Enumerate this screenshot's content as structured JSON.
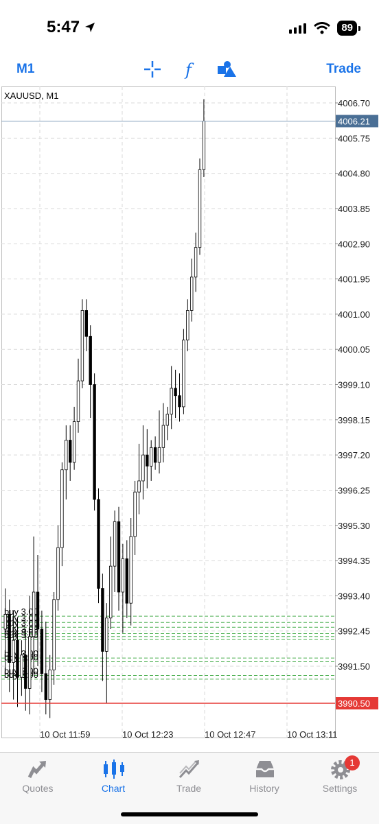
{
  "status": {
    "time": "5:47",
    "battery": "89"
  },
  "toolbar": {
    "timeframe": "M1",
    "trade_label": "Trade"
  },
  "chart": {
    "symbol_label": "XAUUSD, M1",
    "price_ticks": [
      "4006.70",
      "4005.75",
      "4004.80",
      "4003.85",
      "4002.90",
      "4001.95",
      "4001.00",
      "4000.05",
      "3999.10",
      "3998.15",
      "3997.20",
      "3996.25",
      "3995.30",
      "3994.35",
      "3993.40",
      "3992.45",
      "3991.50"
    ],
    "bid_price": "4006.21",
    "entry_price": "3990.50",
    "time_ticks": [
      "10 Oct 11:59",
      "10 Oct 12:23",
      "10 Oct 12:47",
      "10 Oct 13:11"
    ],
    "orders": [
      {
        "label": "buy 3.00",
        "price": 3992.85
      },
      {
        "label": "buy 3.00",
        "price": 3992.68
      },
      {
        "label": "buy 3.00",
        "price": 3992.55
      },
      {
        "label": "buy 3.00",
        "price": 3992.38
      },
      {
        "label": "buy 3.00",
        "price": 3992.3
      },
      {
        "label": "buy 3.00",
        "price": 3992.22
      },
      {
        "label": "buy 3.00",
        "price": 3991.72
      },
      {
        "label": "buy 3.00",
        "price": 3991.62
      },
      {
        "label": "buy 3.00",
        "price": 3991.25
      },
      {
        "label": "buy 3.00",
        "price": 3991.15
      }
    ],
    "colors": {
      "grid": "#d9d9d9",
      "bid_line": "#7f9bb8",
      "bid_label_bg": "#4a6f95",
      "entry_line": "#e53935",
      "entry_label_bg": "#e53935",
      "order_line": "#4caf50"
    }
  },
  "chart_data": {
    "type": "candlestick",
    "symbol": "XAUUSD",
    "timeframe": "M1",
    "ylim": [
      3990.0,
      4007.3
    ],
    "candles": [
      {
        "o": 3992.5,
        "h": 3993.6,
        "l": 3991.3,
        "c": 3992.9
      },
      {
        "o": 3992.9,
        "h": 3993.3,
        "l": 3990.8,
        "c": 3991.6
      },
      {
        "o": 3991.6,
        "h": 3993.0,
        "l": 3990.6,
        "c": 3992.2
      },
      {
        "o": 3992.2,
        "h": 3992.8,
        "l": 3990.4,
        "c": 3991.2
      },
      {
        "o": 3991.2,
        "h": 3992.2,
        "l": 3990.7,
        "c": 3991.8
      },
      {
        "o": 3991.8,
        "h": 3992.5,
        "l": 3990.3,
        "c": 3990.9
      },
      {
        "o": 3990.9,
        "h": 3993.4,
        "l": 3990.2,
        "c": 3992.3
      },
      {
        "o": 3992.3,
        "h": 3995.0,
        "l": 3991.3,
        "c": 3993.5
      },
      {
        "o": 3993.5,
        "h": 3994.5,
        "l": 3991.5,
        "c": 3992.5
      },
      {
        "o": 3992.5,
        "h": 3993.0,
        "l": 3990.8,
        "c": 3991.3
      },
      {
        "o": 3991.3,
        "h": 3992.7,
        "l": 3990.2,
        "c": 3990.6
      },
      {
        "o": 3990.6,
        "h": 3991.8,
        "l": 3990.1,
        "c": 3991.4
      },
      {
        "o": 3991.4,
        "h": 3993.5,
        "l": 3991.0,
        "c": 3993.3
      },
      {
        "o": 3993.3,
        "h": 3995.3,
        "l": 3993.0,
        "c": 3994.7
      },
      {
        "o": 3994.7,
        "h": 3997.0,
        "l": 3994.2,
        "c": 3996.8
      },
      {
        "o": 3996.8,
        "h": 3998.0,
        "l": 3996.0,
        "c": 3997.6
      },
      {
        "o": 3997.6,
        "h": 3998.0,
        "l": 3996.5,
        "c": 3997.0
      },
      {
        "o": 3997.0,
        "h": 3998.5,
        "l": 3996.8,
        "c": 3998.1
      },
      {
        "o": 3998.1,
        "h": 3999.8,
        "l": 3997.8,
        "c": 3999.2
      },
      {
        "o": 3999.2,
        "h": 4001.4,
        "l": 3999.0,
        "c": 4001.1
      },
      {
        "o": 4001.1,
        "h": 4001.4,
        "l": 4000.0,
        "c": 4000.4
      },
      {
        "o": 4000.4,
        "h": 4000.7,
        "l": 3998.2,
        "c": 3999.1
      },
      {
        "o": 3999.1,
        "h": 3999.4,
        "l": 3995.7,
        "c": 3996.0
      },
      {
        "o": 3996.0,
        "h": 3996.3,
        "l": 3993.2,
        "c": 3993.6
      },
      {
        "o": 3993.6,
        "h": 3994.0,
        "l": 3991.1,
        "c": 3991.9
      },
      {
        "o": 3991.9,
        "h": 3993.2,
        "l": 3990.5,
        "c": 3992.8
      },
      {
        "o": 3992.8,
        "h": 3995.0,
        "l": 3992.5,
        "c": 3994.2
      },
      {
        "o": 3994.2,
        "h": 3995.7,
        "l": 3993.5,
        "c": 3995.4
      },
      {
        "o": 3995.4,
        "h": 3995.8,
        "l": 3993.0,
        "c": 3993.5
      },
      {
        "o": 3993.5,
        "h": 3994.8,
        "l": 3992.4,
        "c": 3994.4
      },
      {
        "o": 3994.4,
        "h": 3994.9,
        "l": 3992.8,
        "c": 3993.2
      },
      {
        "o": 3993.2,
        "h": 3995.5,
        "l": 3992.6,
        "c": 3995.0
      },
      {
        "o": 3995.0,
        "h": 3996.5,
        "l": 3994.5,
        "c": 3996.2
      },
      {
        "o": 3996.2,
        "h": 3997.5,
        "l": 3995.6,
        "c": 3996.5
      },
      {
        "o": 3996.5,
        "h": 3998.0,
        "l": 3996.0,
        "c": 3997.2
      },
      {
        "o": 3997.2,
        "h": 3997.9,
        "l": 3996.3,
        "c": 3996.9
      },
      {
        "o": 3996.9,
        "h": 3997.6,
        "l": 3996.5,
        "c": 3997.4
      },
      {
        "o": 3997.4,
        "h": 3997.7,
        "l": 3996.8,
        "c": 3997.0
      },
      {
        "o": 3997.0,
        "h": 3998.4,
        "l": 3996.7,
        "c": 3997.4
      },
      {
        "o": 3997.4,
        "h": 3998.6,
        "l": 3997.0,
        "c": 3998.0
      },
      {
        "o": 3998.0,
        "h": 3998.5,
        "l": 3997.6,
        "c": 3998.3
      },
      {
        "o": 3998.3,
        "h": 3999.6,
        "l": 3997.9,
        "c": 3999.0
      },
      {
        "o": 3999.0,
        "h": 3999.5,
        "l": 3998.2,
        "c": 3998.8
      },
      {
        "o": 3998.8,
        "h": 3999.4,
        "l": 3998.1,
        "c": 3998.5
      },
      {
        "o": 3998.5,
        "h": 4000.6,
        "l": 3998.3,
        "c": 4000.3
      },
      {
        "o": 4000.3,
        "h": 4001.4,
        "l": 4000.0,
        "c": 4001.1
      },
      {
        "o": 4001.1,
        "h": 4002.5,
        "l": 4000.8,
        "c": 4002.0
      },
      {
        "o": 4002.0,
        "h": 4003.2,
        "l": 4001.6,
        "c": 4002.8
      },
      {
        "o": 4002.8,
        "h": 4005.2,
        "l": 4002.6,
        "c": 4004.9
      },
      {
        "o": 4004.9,
        "h": 4006.8,
        "l": 4004.7,
        "c": 4006.21
      }
    ]
  },
  "tabs": [
    {
      "label": "Quotes",
      "active": false
    },
    {
      "label": "Chart",
      "active": true
    },
    {
      "label": "Trade",
      "active": false
    },
    {
      "label": "History",
      "active": false
    },
    {
      "label": "Settings",
      "active": false,
      "badge": "1"
    }
  ]
}
